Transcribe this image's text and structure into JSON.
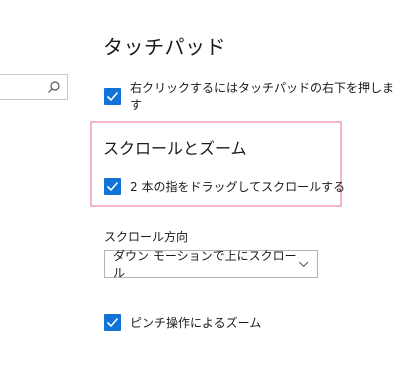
{
  "search": {
    "placeholder": ""
  },
  "touchpad": {
    "title": "タッチパッド",
    "right_click_label": "右クリックするにはタッチパッドの右下を押します",
    "right_click_checked": true
  },
  "scroll_zoom": {
    "heading": "スクロールとズーム",
    "two_finger_scroll_label": "2 本の指をドラッグしてスクロールする",
    "two_finger_scroll_checked": true,
    "scroll_direction_label": "スクロール方向",
    "scroll_direction_value": "ダウン モーションで上にスクロール",
    "pinch_zoom_label": "ピンチ操作によるズーム",
    "pinch_zoom_checked": true
  },
  "colors": {
    "accent": "#1273d6",
    "highlight": "#f2b6d0"
  },
  "icons": {
    "search": "search-icon",
    "checkbox": "checkmark-icon",
    "dropdown": "chevron-down-icon"
  }
}
